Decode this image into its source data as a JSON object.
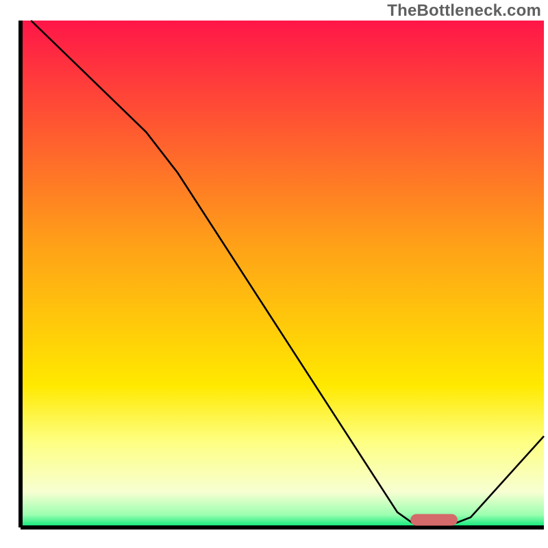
{
  "watermark": "TheBottleneck.com",
  "chart_data": {
    "type": "line",
    "title": "",
    "xlabel": "",
    "ylabel": "",
    "xlim": [
      0,
      100
    ],
    "ylim": [
      0,
      100
    ],
    "axes": {
      "left": true,
      "bottom": true,
      "right": false,
      "top": false,
      "color": "#000000"
    },
    "background_gradient": {
      "stops": [
        {
          "offset": 0.0,
          "color": "#ff1648"
        },
        {
          "offset": 0.45,
          "color": "#ffa317"
        },
        {
          "offset": 0.72,
          "color": "#ffe900"
        },
        {
          "offset": 0.83,
          "color": "#feff81"
        },
        {
          "offset": 0.93,
          "color": "#f7ffd2"
        },
        {
          "offset": 0.975,
          "color": "#9cffb0"
        },
        {
          "offset": 1.0,
          "color": "#00e676"
        }
      ]
    },
    "series": [
      {
        "name": "curve",
        "color": "#000000",
        "width": 2.6,
        "points": [
          {
            "x": 2,
            "y": 100
          },
          {
            "x": 24,
            "y": 78
          },
          {
            "x": 30,
            "y": 70
          },
          {
            "x": 72,
            "y": 3
          },
          {
            "x": 75,
            "y": 0.8
          },
          {
            "x": 83,
            "y": 0.8
          },
          {
            "x": 86,
            "y": 2
          },
          {
            "x": 100,
            "y": 18
          }
        ]
      }
    ],
    "marker": {
      "shape": "rounded-rect",
      "center_x": 79,
      "center_y": 1.5,
      "width": 9,
      "height": 2.3,
      "corner_radius": 1.2,
      "color": "#d46a6a"
    }
  }
}
